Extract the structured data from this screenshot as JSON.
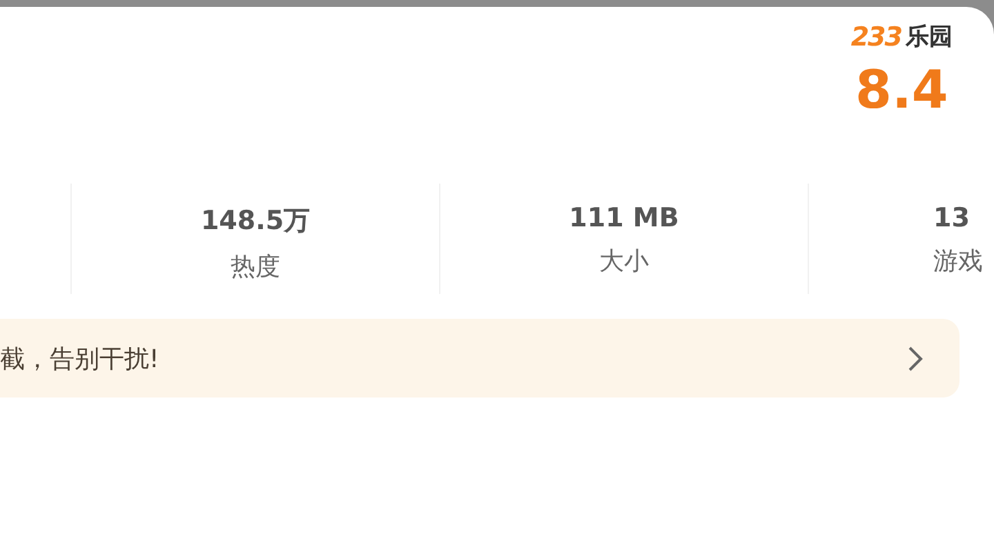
{
  "brand": {
    "number": "233",
    "name": "乐园"
  },
  "rating": "8.4",
  "stats": [
    {
      "value": "148.5万",
      "label": "热度"
    },
    {
      "value": "111 MB",
      "label": "大小"
    },
    {
      "value": "13",
      "label": "游戏"
    }
  ],
  "banner": {
    "text": "截，告别干扰!"
  }
}
